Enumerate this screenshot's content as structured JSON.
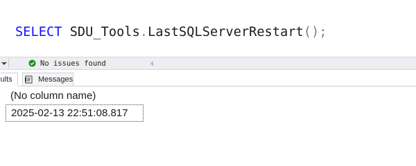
{
  "editor": {
    "keyword": "SELECT",
    "object": "SDU_Tools",
    "dot": ".",
    "function": "LastSQLServerRestart",
    "parens": "()",
    "terminator": ";"
  },
  "status": {
    "message": "No issues found"
  },
  "tabs": [
    {
      "label": "Results"
    },
    {
      "label": "Messages"
    }
  ],
  "results": {
    "columns": [
      "(No column name)"
    ],
    "rows": [
      [
        "2025-02-13 22:51:08.817"
      ]
    ]
  },
  "colors": {
    "keyword": "#1010ff",
    "function": "#ff00ff",
    "punctuation": "#808080",
    "ok_green": "#1f8a1f"
  }
}
